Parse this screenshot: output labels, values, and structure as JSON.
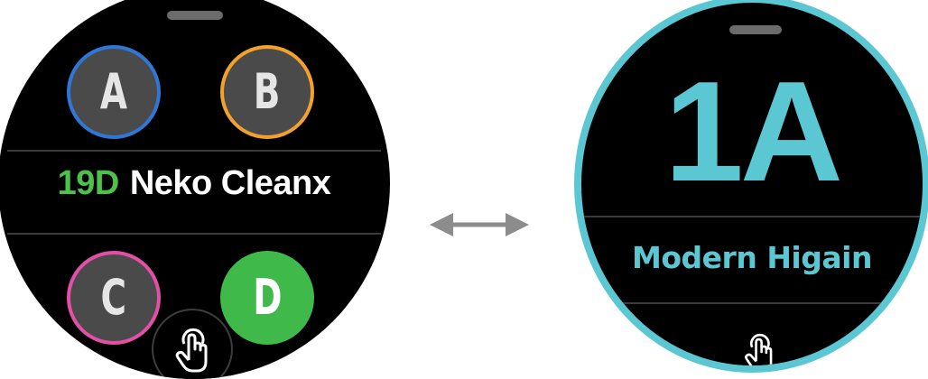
{
  "left_screen": {
    "options": [
      {
        "letter": "A",
        "ring_color": "#2f77d6"
      },
      {
        "letter": "B",
        "ring_color": "#f2a12a"
      },
      {
        "letter": "C",
        "ring_color": "#e24fa6"
      },
      {
        "letter": "D",
        "fill_color": "#3fb94a"
      }
    ],
    "title_code": "19D",
    "title_name": "Neko Cleanx",
    "code_color": "#4cc24a"
  },
  "right_screen": {
    "code": "1A",
    "name": "Modern Higain",
    "accent_color": "#5bc7d3"
  },
  "icons": {
    "tap": "tap-hand-icon",
    "swap": "double-arrow-icon",
    "grabber": "drag-handle"
  }
}
